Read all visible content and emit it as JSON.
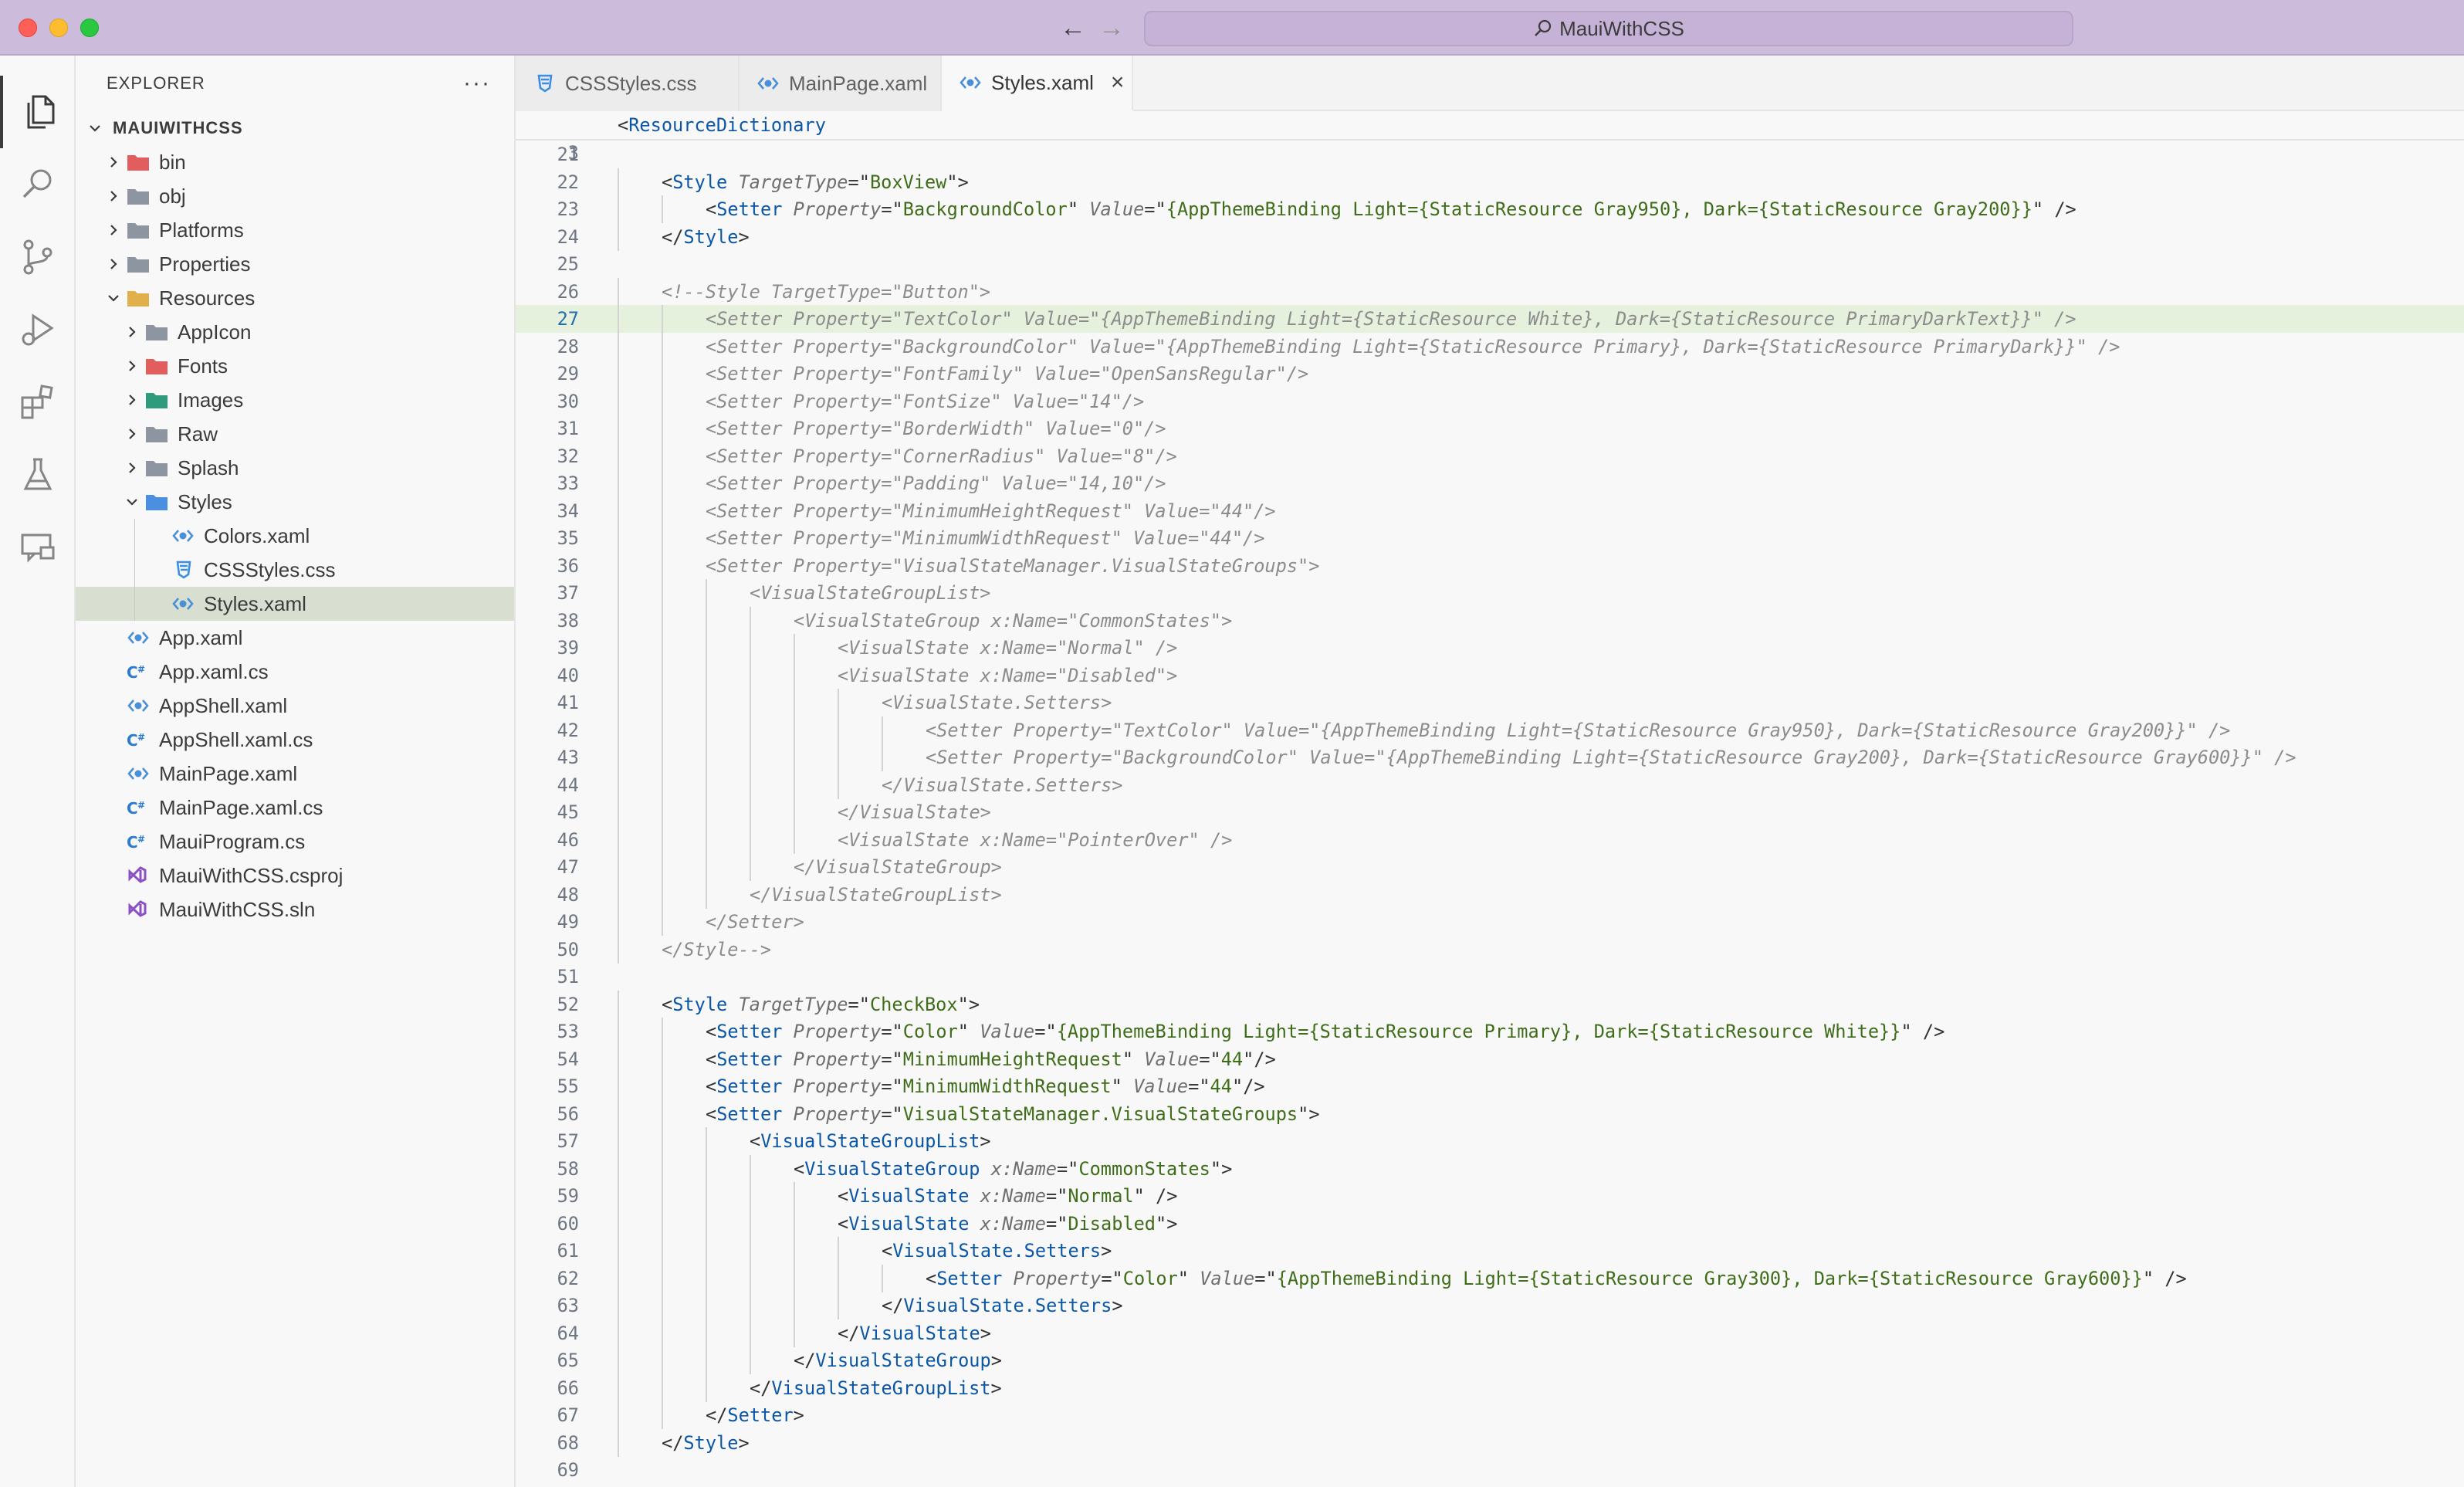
{
  "window": {
    "search_text": "MauiWithCSS"
  },
  "sidebar": {
    "title": "EXPLORER",
    "more": "···",
    "root": "MAUIWITHCSS",
    "items": [
      {
        "label": "bin",
        "icon": "folder-bin-icon",
        "indent": 1,
        "type": "folder",
        "expanded": false,
        "color": "#e25d5d"
      },
      {
        "label": "obj",
        "icon": "folder-icon",
        "indent": 1,
        "type": "folder",
        "expanded": false,
        "color": "#8d96a0"
      },
      {
        "label": "Platforms",
        "icon": "folder-icon",
        "indent": 1,
        "type": "folder",
        "expanded": false,
        "color": "#8d96a0"
      },
      {
        "label": "Properties",
        "icon": "folder-icon",
        "indent": 1,
        "type": "folder",
        "expanded": false,
        "color": "#8d96a0"
      },
      {
        "label": "Resources",
        "icon": "folder-resources-icon",
        "indent": 1,
        "type": "folder",
        "expanded": true,
        "color": "#e2b04a"
      },
      {
        "label": "AppIcon",
        "icon": "folder-icon",
        "indent": 2,
        "type": "folder",
        "expanded": false,
        "color": "#8d96a0"
      },
      {
        "label": "Fonts",
        "icon": "folder-fonts-icon",
        "indent": 2,
        "type": "folder",
        "expanded": false,
        "color": "#e25d5d"
      },
      {
        "label": "Images",
        "icon": "folder-images-icon",
        "indent": 2,
        "type": "folder",
        "expanded": false,
        "color": "#2e9b7c"
      },
      {
        "label": "Raw",
        "icon": "folder-icon",
        "indent": 2,
        "type": "folder",
        "expanded": false,
        "color": "#8d96a0"
      },
      {
        "label": "Splash",
        "icon": "folder-icon",
        "indent": 2,
        "type": "folder",
        "expanded": false,
        "color": "#8d96a0"
      },
      {
        "label": "Styles",
        "icon": "folder-styles-icon",
        "indent": 2,
        "type": "folder",
        "expanded": true,
        "color": "#4a8fe2"
      },
      {
        "label": "Colors.xaml",
        "icon": "xaml-file-icon",
        "indent": 3,
        "type": "xaml"
      },
      {
        "label": "CSSStyles.css",
        "icon": "css-file-icon",
        "indent": 3,
        "type": "css"
      },
      {
        "label": "Styles.xaml",
        "icon": "xaml-file-icon",
        "indent": 3,
        "type": "xaml",
        "selected": true
      },
      {
        "label": "App.xaml",
        "icon": "xaml-file-icon",
        "indent": 1,
        "type": "xaml"
      },
      {
        "label": "App.xaml.cs",
        "icon": "csharp-file-icon",
        "indent": 1,
        "type": "cs"
      },
      {
        "label": "AppShell.xaml",
        "icon": "xaml-file-icon",
        "indent": 1,
        "type": "xaml"
      },
      {
        "label": "AppShell.xaml.cs",
        "icon": "csharp-file-icon",
        "indent": 1,
        "type": "cs"
      },
      {
        "label": "MainPage.xaml",
        "icon": "xaml-file-icon",
        "indent": 1,
        "type": "xaml"
      },
      {
        "label": "MainPage.xaml.cs",
        "icon": "csharp-file-icon",
        "indent": 1,
        "type": "cs"
      },
      {
        "label": "MauiProgram.cs",
        "icon": "csharp-file-icon",
        "indent": 1,
        "type": "cs"
      },
      {
        "label": "MauiWithCSS.csproj",
        "icon": "vs-project-icon",
        "indent": 1,
        "type": "proj"
      },
      {
        "label": "MauiWithCSS.sln",
        "icon": "vs-solution-icon",
        "indent": 1,
        "type": "proj"
      }
    ]
  },
  "tabs": [
    {
      "label": "CSSStyles.css",
      "icon": "css-file-icon",
      "type": "css",
      "active": false
    },
    {
      "label": "MainPage.xaml",
      "icon": "xaml-file-icon",
      "type": "xaml",
      "active": false
    },
    {
      "label": "Styles.xaml",
      "icon": "xaml-file-icon",
      "type": "xaml",
      "active": true,
      "close": "×"
    }
  ],
  "editor": {
    "sticky": {
      "num": "3",
      "text": "<ResourceDictionary"
    },
    "current_line": 27,
    "lines": [
      {
        "n": 21,
        "d": 0,
        "t": ""
      },
      {
        "n": 22,
        "d": 1,
        "t": "<Style TargetType=\"BoxView\">"
      },
      {
        "n": 23,
        "d": 2,
        "t": "<Setter Property=\"BackgroundColor\" Value=\"{AppThemeBinding Light={StaticResource Gray950}, Dark={StaticResource Gray200}}\" />"
      },
      {
        "n": 24,
        "d": 1,
        "t": "</Style>"
      },
      {
        "n": 25,
        "d": 0,
        "t": ""
      },
      {
        "n": 26,
        "d": 1,
        "t": "<!--Style TargetType=\"Button\">",
        "c": true
      },
      {
        "n": 27,
        "d": 2,
        "t": "<Setter Property=\"TextColor\" Value=\"{AppThemeBinding Light={StaticResource White}, Dark={StaticResource PrimaryDarkText}}\" />",
        "c": true
      },
      {
        "n": 28,
        "d": 2,
        "t": "<Setter Property=\"BackgroundColor\" Value=\"{AppThemeBinding Light={StaticResource Primary}, Dark={StaticResource PrimaryDark}}\" />",
        "c": true
      },
      {
        "n": 29,
        "d": 2,
        "t": "<Setter Property=\"FontFamily\" Value=\"OpenSansRegular\"/>",
        "c": true
      },
      {
        "n": 30,
        "d": 2,
        "t": "<Setter Property=\"FontSize\" Value=\"14\"/>",
        "c": true
      },
      {
        "n": 31,
        "d": 2,
        "t": "<Setter Property=\"BorderWidth\" Value=\"0\"/>",
        "c": true
      },
      {
        "n": 32,
        "d": 2,
        "t": "<Setter Property=\"CornerRadius\" Value=\"8\"/>",
        "c": true
      },
      {
        "n": 33,
        "d": 2,
        "t": "<Setter Property=\"Padding\" Value=\"14,10\"/>",
        "c": true
      },
      {
        "n": 34,
        "d": 2,
        "t": "<Setter Property=\"MinimumHeightRequest\" Value=\"44\"/>",
        "c": true
      },
      {
        "n": 35,
        "d": 2,
        "t": "<Setter Property=\"MinimumWidthRequest\" Value=\"44\"/>",
        "c": true
      },
      {
        "n": 36,
        "d": 2,
        "t": "<Setter Property=\"VisualStateManager.VisualStateGroups\">",
        "c": true
      },
      {
        "n": 37,
        "d": 3,
        "t": "<VisualStateGroupList>",
        "c": true
      },
      {
        "n": 38,
        "d": 4,
        "t": "<VisualStateGroup x:Name=\"CommonStates\">",
        "c": true
      },
      {
        "n": 39,
        "d": 5,
        "t": "<VisualState x:Name=\"Normal\" />",
        "c": true
      },
      {
        "n": 40,
        "d": 5,
        "t": "<VisualState x:Name=\"Disabled\">",
        "c": true
      },
      {
        "n": 41,
        "d": 6,
        "t": "<VisualState.Setters>",
        "c": true
      },
      {
        "n": 42,
        "d": 7,
        "t": "<Setter Property=\"TextColor\" Value=\"{AppThemeBinding Light={StaticResource Gray950}, Dark={StaticResource Gray200}}\" />",
        "c": true
      },
      {
        "n": 43,
        "d": 7,
        "t": "<Setter Property=\"BackgroundColor\" Value=\"{AppThemeBinding Light={StaticResource Gray200}, Dark={StaticResource Gray600}}\" />",
        "c": true
      },
      {
        "n": 44,
        "d": 6,
        "t": "</VisualState.Setters>",
        "c": true
      },
      {
        "n": 45,
        "d": 5,
        "t": "</VisualState>",
        "c": true
      },
      {
        "n": 46,
        "d": 5,
        "t": "<VisualState x:Name=\"PointerOver\" />",
        "c": true
      },
      {
        "n": 47,
        "d": 4,
        "t": "</VisualStateGroup>",
        "c": true
      },
      {
        "n": 48,
        "d": 3,
        "t": "</VisualStateGroupList>",
        "c": true
      },
      {
        "n": 49,
        "d": 2,
        "t": "</Setter>",
        "c": true
      },
      {
        "n": 50,
        "d": 1,
        "t": "</Style-->",
        "c": true
      },
      {
        "n": 51,
        "d": 0,
        "t": ""
      },
      {
        "n": 52,
        "d": 1,
        "t": "<Style TargetType=\"CheckBox\">"
      },
      {
        "n": 53,
        "d": 2,
        "t": "<Setter Property=\"Color\" Value=\"{AppThemeBinding Light={StaticResource Primary}, Dark={StaticResource White}}\" />"
      },
      {
        "n": 54,
        "d": 2,
        "t": "<Setter Property=\"MinimumHeightRequest\" Value=\"44\"/>"
      },
      {
        "n": 55,
        "d": 2,
        "t": "<Setter Property=\"MinimumWidthRequest\" Value=\"44\"/>"
      },
      {
        "n": 56,
        "d": 2,
        "t": "<Setter Property=\"VisualStateManager.VisualStateGroups\">"
      },
      {
        "n": 57,
        "d": 3,
        "t": "<VisualStateGroupList>"
      },
      {
        "n": 58,
        "d": 4,
        "t": "<VisualStateGroup x:Name=\"CommonStates\">"
      },
      {
        "n": 59,
        "d": 5,
        "t": "<VisualState x:Name=\"Normal\" />"
      },
      {
        "n": 60,
        "d": 5,
        "t": "<VisualState x:Name=\"Disabled\">"
      },
      {
        "n": 61,
        "d": 6,
        "t": "<VisualState.Setters>"
      },
      {
        "n": 62,
        "d": 7,
        "t": "<Setter Property=\"Color\" Value=\"{AppThemeBinding Light={StaticResource Gray300}, Dark={StaticResource Gray600}}\" />"
      },
      {
        "n": 63,
        "d": 6,
        "t": "</VisualState.Setters>"
      },
      {
        "n": 64,
        "d": 5,
        "t": "</VisualState>"
      },
      {
        "n": 65,
        "d": 4,
        "t": "</VisualStateGroup>"
      },
      {
        "n": 66,
        "d": 3,
        "t": "</VisualStateGroupList>"
      },
      {
        "n": 67,
        "d": 2,
        "t": "</Setter>"
      },
      {
        "n": 68,
        "d": 1,
        "t": "</Style>"
      },
      {
        "n": 69,
        "d": 0,
        "t": ""
      }
    ]
  },
  "colors": {
    "titlebar": "#cdbbdc",
    "selection": "#d9dfd0",
    "current_line": "#e5f1dd",
    "tag": "#0b57a6",
    "attribute": "#6f6f6f",
    "value": "#3f6d1a",
    "comment": "#8c8c8c"
  }
}
